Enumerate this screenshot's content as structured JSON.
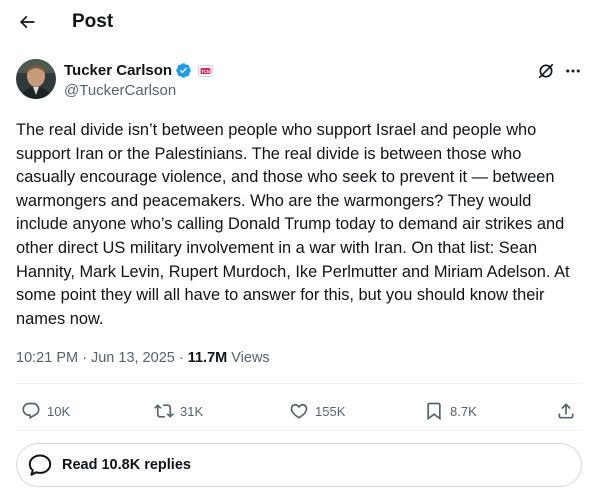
{
  "header": {
    "title": "Post",
    "back_icon": "arrow-left-icon"
  },
  "author": {
    "name": "Tucker Carlson",
    "handle": "@TuckerCarlson",
    "verified_color": "#1d9bf0",
    "verified_icon": "verified-badge-icon",
    "affiliation_icon": "affiliation-badge-icon"
  },
  "post": {
    "text": "The real divide isn’t between people who support Israel and people who support Iran or the Palestinians. The real divide is between those who casually encourage violence, and those who seek to prevent it — between warmongers and peacemakers. Who are the warmongers? They would include anyone who’s calling Donald Trump today to demand air strikes and other direct US military involvement in a war with Iran. On that list: Sean Hannity, Mark Levin, Rupert Murdoch, Ike Perlmutter and Miriam Adelson. At some point they will all have to answer for this, but you should know their names now.",
    "time": "10:21 PM",
    "separator": " · ",
    "date": "Jun 13, 2025",
    "views_count": "11.7M",
    "views_label": "Views"
  },
  "actions": {
    "reply": {
      "icon": "reply-icon",
      "count": "10K"
    },
    "repost": {
      "icon": "repost-icon",
      "count": "31K"
    },
    "like": {
      "icon": "heart-icon",
      "count": "155K"
    },
    "bookmark": {
      "icon": "bookmark-icon",
      "count": "8.7K"
    },
    "share": {
      "icon": "share-icon"
    }
  },
  "replies_button": {
    "label": "Read 10.8K replies",
    "icon": "speech-bubble-icon"
  },
  "colors": {
    "text": "#0f1419",
    "secondary": "#536471",
    "accent": "#1d9bf0",
    "border": "#cfd9de",
    "divider": "#eff3f4"
  }
}
